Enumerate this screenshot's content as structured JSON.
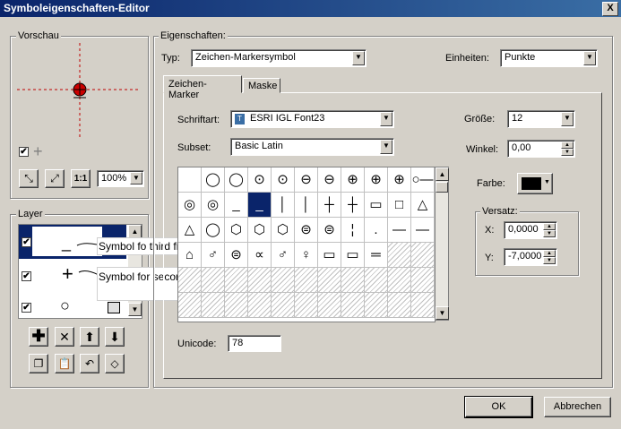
{
  "window": {
    "title": "Symboleigenschaften-Editor",
    "close": "X"
  },
  "preview": {
    "label": "Vorschau",
    "zoom": "100%",
    "plus_glyph": "+"
  },
  "layer": {
    "label": "Layer",
    "rows": [
      {
        "glyph": "_",
        "checked": "✔"
      },
      {
        "glyph": "+",
        "checked": "✔"
      },
      {
        "glyph": "○",
        "checked": "✔"
      }
    ],
    "tooltip_third": "Symbol fo third field",
    "tooltip_second": "Symbol for second field"
  },
  "props": {
    "label": "Eigenschaften:",
    "typ_label": "Typ:",
    "typ_value": "Zeichen-Markersymbol",
    "units_label": "Einheiten:",
    "units_value": "Punkte",
    "tabs": [
      "Zeichen-Marker",
      "Maske"
    ]
  },
  "marker": {
    "font_label": "Schriftart:",
    "font_value": "ESRI IGL Font23",
    "subset_label": "Subset:",
    "subset_value": "Basic Latin",
    "size_label": "Größe:",
    "size_value": "12",
    "angle_label": "Winkel:",
    "angle_value": "0,00",
    "color_label": "Farbe:",
    "offset_label": "Versatz:",
    "x_label": "X:",
    "x_value": "0,0000",
    "y_label": "Y:",
    "y_value": "-7,0000",
    "unicode_label": "Unicode:",
    "unicode_value": "78",
    "glyphs": [
      "",
      "◯",
      "◯",
      "⊙",
      "⊙",
      "⊖",
      "⊖",
      "⊕",
      "⊕",
      "⊕",
      "○—",
      "◎",
      "◎",
      "_",
      "_",
      "│",
      "│",
      "┼",
      "┼",
      "▭",
      "□",
      "△",
      "△",
      "◯",
      "⬡",
      "⬡",
      "⬡",
      "⊜",
      "⊜",
      "¦",
      ".",
      "—",
      "—",
      "⌂",
      "♂",
      "⊜",
      "∝",
      "♂",
      "♀",
      "▭",
      "▭",
      "═",
      "",
      ""
    ],
    "selected_index": 14
  },
  "buttons": {
    "ok": "OK",
    "cancel": "Abbrechen"
  }
}
